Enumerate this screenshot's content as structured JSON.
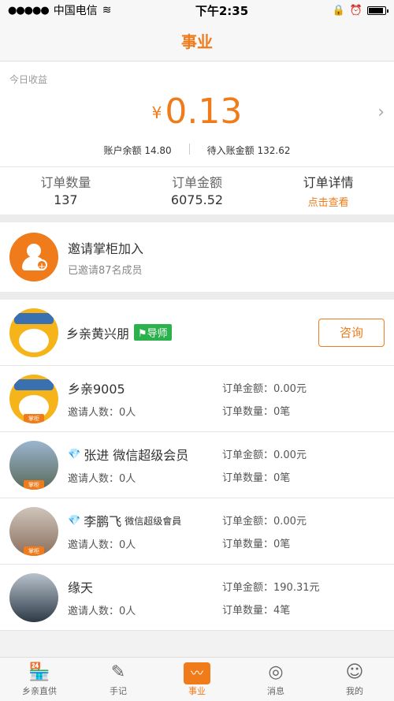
{
  "status": {
    "carrier": "中国电信",
    "signal": "●●●●●",
    "time": "下午2:35",
    "alarm": "⏰",
    "lock": "🔒",
    "battery_level": 0.8
  },
  "nav": {
    "title": "事业"
  },
  "earnings": {
    "label": "今日收益",
    "currency": "¥",
    "amount": "0.13",
    "balance": "账户余额 14.80",
    "pending": "待入账金额 132.62"
  },
  "stats": [
    {
      "title": "订单数量",
      "value": "137"
    },
    {
      "title": "订单金额",
      "value": "6075.52"
    },
    {
      "title": "订单详情",
      "value": "点击查看"
    }
  ],
  "invite": {
    "title": "邀请掌柜加入",
    "subtitle": "已邀请87名成员"
  },
  "mentor": {
    "name": "乡亲黄兴朋",
    "tag": "导师",
    "button": "咨询"
  },
  "members": [
    {
      "name": "乡亲9005",
      "sub": "",
      "invites": "邀请人数：0人",
      "amount": "订单金额：0.00元",
      "count": "订单数量：0笔",
      "badge": "掌柜"
    },
    {
      "name": "张进 微信超级会员",
      "sub": "",
      "invites": "邀请人数：0人",
      "amount": "订单金额：0.00元",
      "count": "订单数量：0笔",
      "badge": "掌柜"
    },
    {
      "name": "李鹏飞",
      "sub": "微信超级會員",
      "invites": "邀请人数：0人",
      "amount": "订单金额：0.00元",
      "count": "订单数量：0笔",
      "badge": "掌柜"
    },
    {
      "name": "缘天",
      "sub": "",
      "invites": "邀请人数：0人",
      "amount": "订单金额：190.31元",
      "count": "订单数量：4笔",
      "badge": ""
    }
  ],
  "tabs": [
    {
      "label": "乡亲直供",
      "icon": "🏪"
    },
    {
      "label": "手记",
      "icon": "✎"
    },
    {
      "label": "事业",
      "icon": "〰"
    },
    {
      "label": "消息",
      "icon": "◎"
    },
    {
      "label": "我的",
      "icon": "☺"
    }
  ]
}
